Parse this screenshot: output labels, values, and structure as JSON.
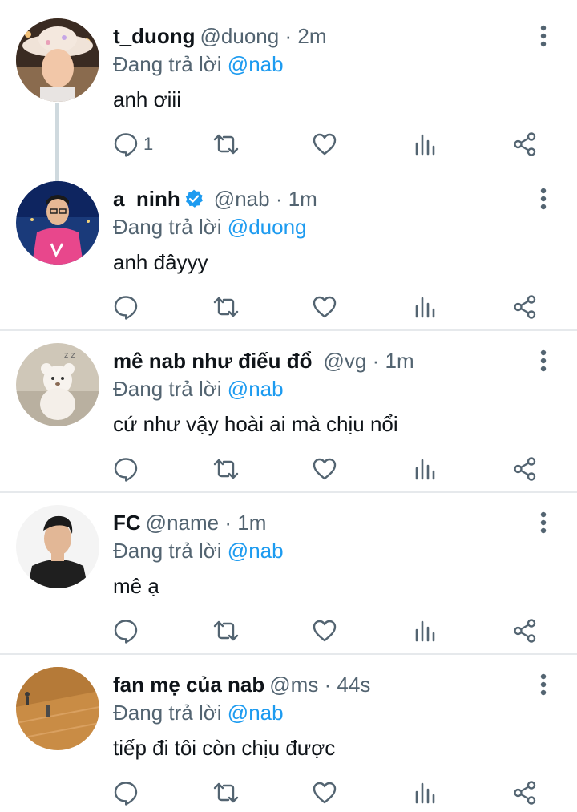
{
  "colors": {
    "text": "#0f1419",
    "secondary": "#536471",
    "link": "#1d9bf0",
    "divider": "#e6e9ec",
    "thread_line": "#cfd9de"
  },
  "icons": [
    "reply-icon",
    "retweet-icon",
    "like-icon",
    "views-icon",
    "share-icon",
    "more-icon",
    "verified-icon"
  ],
  "replying_prefix": "Đang trả lời",
  "tweets": [
    {
      "name": "t_duong",
      "handle": "@duong",
      "dot": "·",
      "time": "2m",
      "verified": false,
      "reply_to": "@nab",
      "text": "anh ơiii",
      "reply_count": "1"
    },
    {
      "name": "a_ninh",
      "handle": "@nab",
      "dot": "·",
      "time": "1m",
      "verified": true,
      "reply_to": "@duong",
      "text": "anh đâyyy",
      "reply_count": ""
    },
    {
      "name": "mê nab như điếu đổ",
      "handle": "@vg",
      "dot": "·",
      "time": "1m",
      "verified": false,
      "reply_to": "@nab",
      "text": "cứ như vậy hoài ai mà chịu nổi",
      "reply_count": ""
    },
    {
      "name": "FC",
      "handle": "@name",
      "dot": "·",
      "time": "1m",
      "verified": false,
      "reply_to": "@nab",
      "text": "mê ạ",
      "reply_count": ""
    },
    {
      "name": "fan mẹ của nab",
      "handle": "@ms",
      "dot": "·",
      "time": "44s",
      "verified": false,
      "reply_to": "@nab",
      "text": "tiếp đi tôi còn chịu được",
      "reply_count": ""
    }
  ]
}
